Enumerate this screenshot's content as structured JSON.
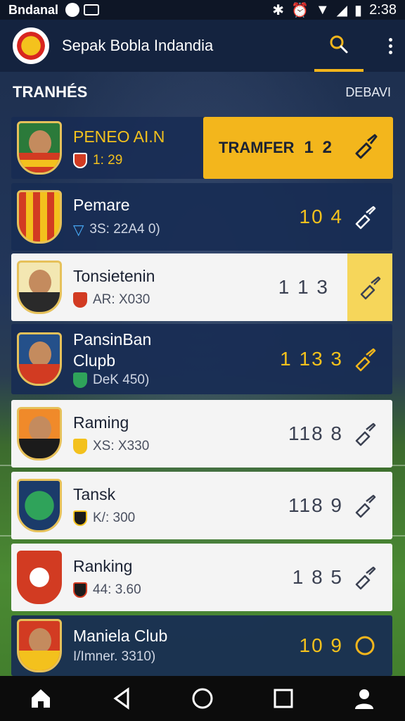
{
  "status_bar": {
    "carrier": "Bndanal",
    "time": "2:38",
    "icons": [
      "bluetooth-icon",
      "alarm-icon",
      "wifi-icon",
      "signal-icon",
      "battery-icon"
    ]
  },
  "app_bar": {
    "title": "Sepak Bobla Indandia",
    "icons": [
      "search-icon",
      "more-vert-icon"
    ]
  },
  "section": {
    "title": "TRANHÉS",
    "action": "DEBAVI"
  },
  "transfer_button": {
    "label": "TRAMFER",
    "count": "1 2"
  },
  "rows": [
    {
      "name": "PENEO AI.N",
      "meta": "1: 29",
      "score": "",
      "style": "first"
    },
    {
      "name": "Pemare",
      "meta": "3S: 22A4 0)",
      "score": "10 4",
      "style": "dark"
    },
    {
      "name": "Tonsietenin",
      "meta": "AR: X030",
      "score": "1 1 3",
      "style": "light-highlight"
    },
    {
      "name_line1": "PansinBan",
      "name_line2": "Clupb",
      "meta": "DeK 450)",
      "score": "1 13 3",
      "style": "dark"
    },
    {
      "name": "Raming",
      "meta": "XS: X330",
      "score": "118 8",
      "style": "light"
    },
    {
      "name": "Tansk",
      "meta": "K/: 300",
      "score": "118 9",
      "style": "light"
    },
    {
      "name": "Ranking",
      "meta": "44: 3.60",
      "score": "1 8 5",
      "style": "light"
    },
    {
      "name": "Maniela Club",
      "meta": "I/Imner. 3310)",
      "score": "10 9",
      "style": "dark"
    }
  ],
  "colors": {
    "accent": "#f3b61c",
    "appbar": "#14233f",
    "row_dark": "#182c54",
    "row_light": "#f4f4f4"
  },
  "nav_bar": {
    "icons": [
      "home-icon",
      "back-icon",
      "home-circle-icon",
      "recents-icon",
      "profile-icon"
    ]
  }
}
